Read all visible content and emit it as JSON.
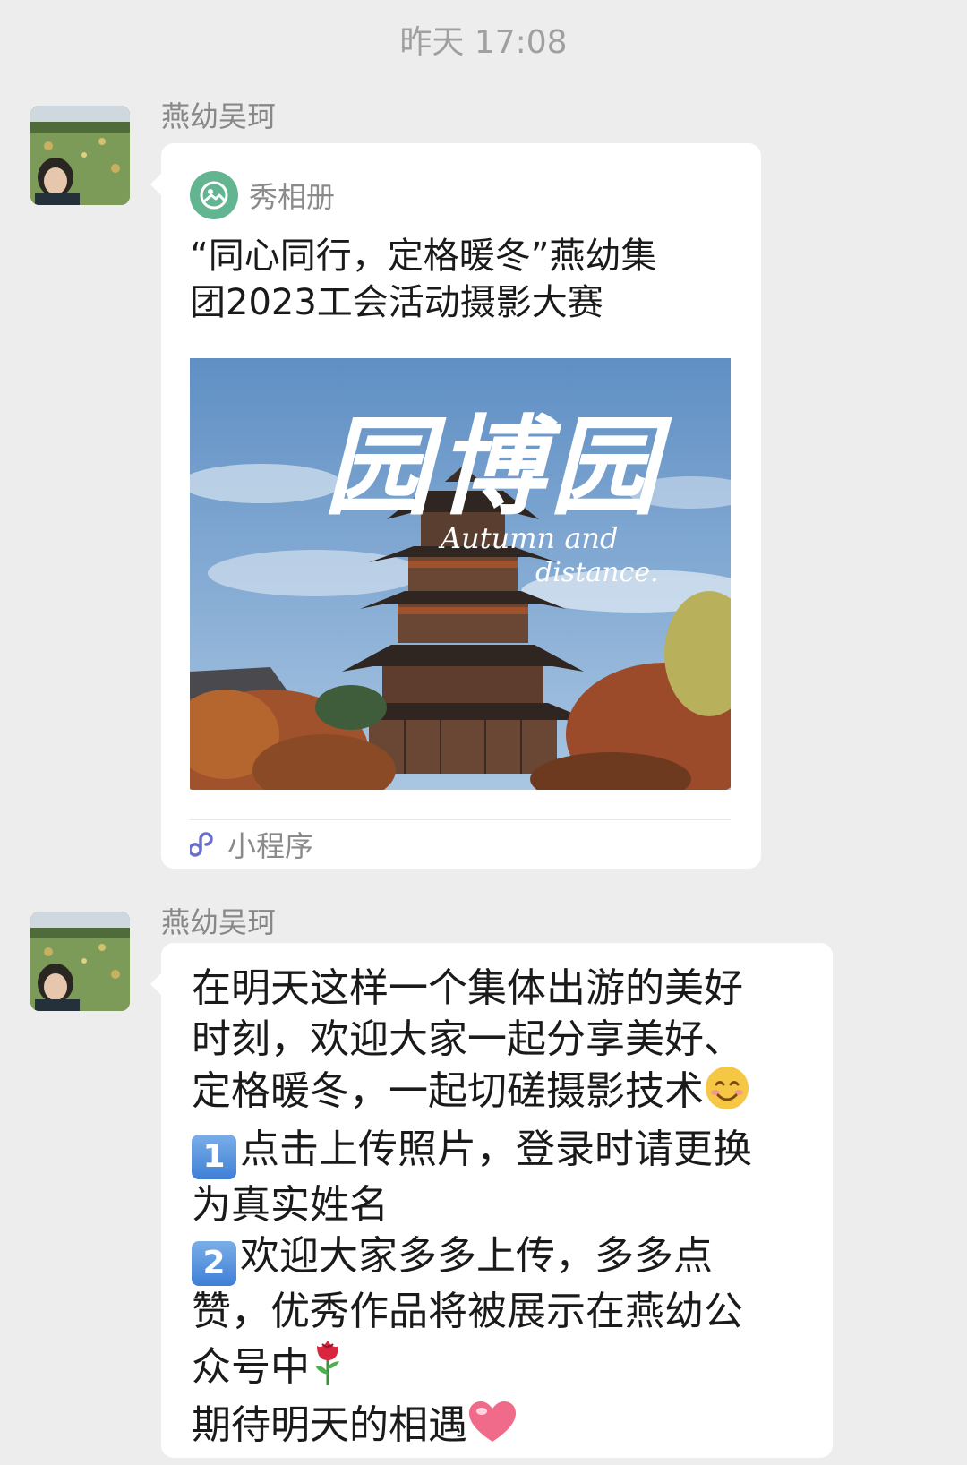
{
  "timestamp": "昨天 17:08",
  "messages": [
    {
      "sender": "燕幼吴珂",
      "card": {
        "app_name": "秀相册",
        "title_line1": "“同心同行，定格暖冬”燕幼集",
        "title_line2": "团2023工会活动摄影大赛",
        "image_text_cn": "园博园",
        "image_text_en1": "Autumn and",
        "image_text_en2": "distance.",
        "footer_label": "小程序"
      }
    },
    {
      "sender": "燕幼吴珂",
      "lines": {
        "l1": "在明天这样一个集体出游的美好",
        "l2": "时刻，欢迎大家一起分享美好、",
        "l3": "定格暖冬，一起切磋摄影技术",
        "l3_emoji": "smiling-face",
        "l4_num": "1",
        "l4": "点击上传照片，登录时请更换",
        "l5": "为真实姓名",
        "l6_num": "2",
        "l6": "欢迎大家多多上传，多多点",
        "l7": "赞，优秀作品将被展示在燕幼公",
        "l8": "众号中",
        "l8_emoji": "rose",
        "l9": "期待明天的相遇",
        "l9_emoji": "red-heart"
      }
    }
  ],
  "colors": {
    "background": "#ededed",
    "bubble": "#ffffff",
    "app_icon": "#63b591",
    "meta_text": "#8a8a8a"
  }
}
